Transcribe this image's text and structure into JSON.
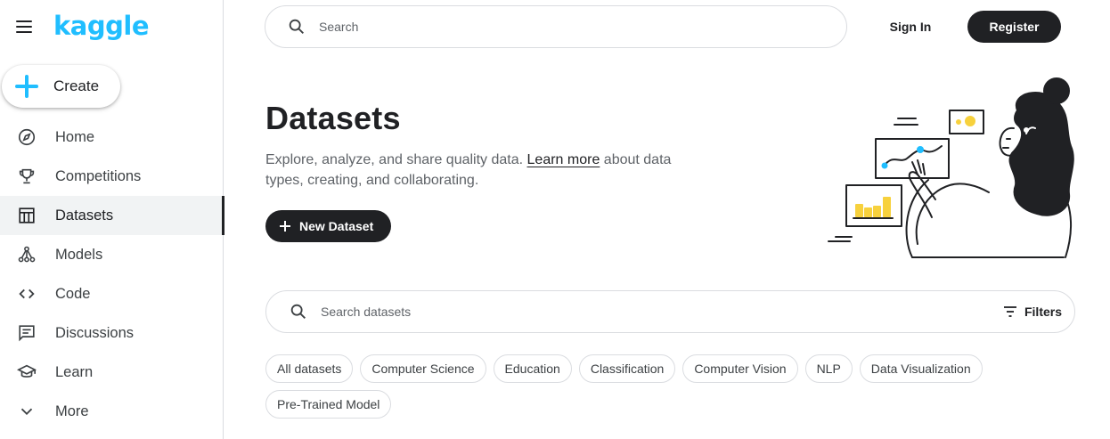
{
  "brand": {
    "logo_text": "kaggle",
    "accent_color": "#20beff",
    "dark_color": "#202124"
  },
  "sidebar": {
    "create_label": "Create",
    "items": [
      {
        "label": "Home",
        "icon": "compass-icon",
        "active": false
      },
      {
        "label": "Competitions",
        "icon": "trophy-icon",
        "active": false
      },
      {
        "label": "Datasets",
        "icon": "table-icon",
        "active": true
      },
      {
        "label": "Models",
        "icon": "models-icon",
        "active": false
      },
      {
        "label": "Code",
        "icon": "code-icon",
        "active": false
      },
      {
        "label": "Discussions",
        "icon": "discussion-icon",
        "active": false
      },
      {
        "label": "Learn",
        "icon": "graduation-cap-icon",
        "active": false
      },
      {
        "label": "More",
        "icon": "chevron-down-icon",
        "active": false
      }
    ]
  },
  "header": {
    "search_placeholder": "Search",
    "sign_in_label": "Sign In",
    "register_label": "Register"
  },
  "hero": {
    "title": "Datasets",
    "description_before": "Explore, analyze, and share quality data. ",
    "learn_more_label": "Learn more",
    "description_after": " about data types, creating, and collaborating.",
    "new_dataset_label": "New Dataset"
  },
  "dataset_search": {
    "placeholder": "Search datasets",
    "filters_label": "Filters"
  },
  "chips": [
    "All datasets",
    "Computer Science",
    "Education",
    "Classification",
    "Computer Vision",
    "NLP",
    "Data Visualization",
    "Pre-Trained Model"
  ]
}
